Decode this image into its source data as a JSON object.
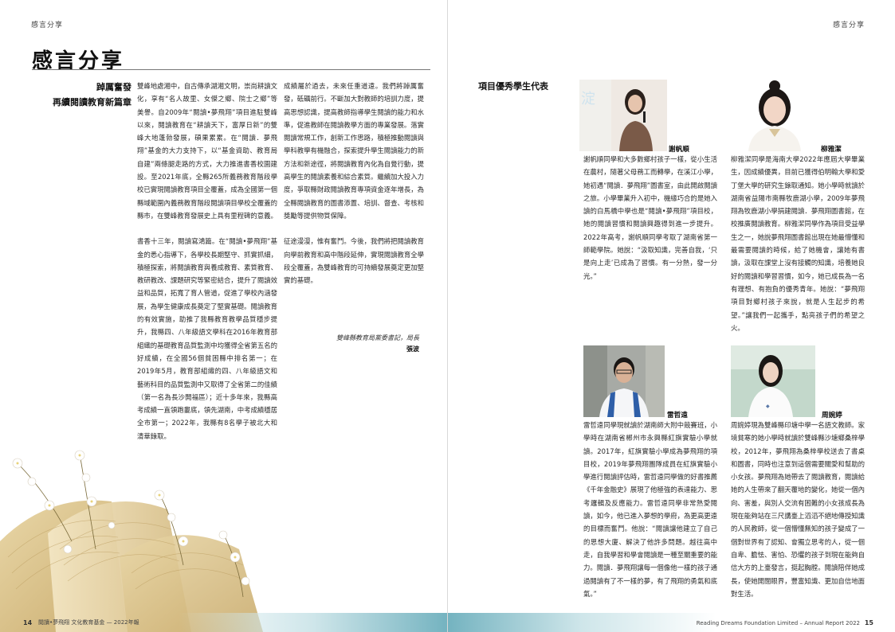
{
  "left_page": {
    "running_head": "感言分享",
    "title": "感言分享",
    "headline_line1": "踔厲奮發",
    "headline_line2": "再續閱讀教育新篇章",
    "col_a_p1": "雙峰地處湘中，自古傳承湖湘文明，崇尚耕讀文化，享有“名人故里、女傑之鄉、院士之鄉”等美譽。自2009年“閱讀•夢飛翔”項目進駐雙峰以來，閱讀教育在“耕讀天下，富厚日新”的雙峰大地蓬勃發展，碩果累累。在“閱讀．夢飛翔”基金的大力支持下，以“基金資助、教育局自建”兩條腿走路的方式，大力推進書香校園建設。至2021年底，全縣265所義務教育階段學校已實現閱讀教育項目全覆蓋，成為全國第一個縣域範圍內義務教育階段閱讀項目學校全覆蓋的縣市，在雙峰教育發展史上具有里程碑的意義。",
    "col_a_p2": "書香十三年，閱讀寫鴻篇。在“閱讀•夢飛翔”基金的悉心指導下，各學校長期堅守、抓實抓細，積極探索，將閱讀教育與養成教育、素質教育、教研教改、課題研究等緊密結合，提升了閱讀效益和品質，拓寬了育人管道，促進了學校內涵發展，為學生健康成長奠定了堅實基礎。閱讀教育的有效實施，助推了我縣教育教學品質穩步提升，我縣四、八年級語文學科在2016年教育部組織的基礎教育品質監測中均獲得全省第五名的好成績，在全國56個貧困縣中排名第一；在2019年5月，教育部組織的四、八年級語文和藝術科目的品質監測中又取得了全省第二的佳績（第一名為長沙開福區）；近十多年來，我縣高考成績一直領跑婁底，領先湖南，中考成績穩居全市第一；2022年，我縣有8名學子被北大和清華錄取。",
    "col_b_p1": "成績屬於過去，未來任重道遠。我們將踔厲奮發，砥礪前行。不斷加大對教師的培訓力度，提高思想認識，提高教師指導學生閱讀的能力和水準，促進教師在閱讀教學方面的專業發展。落實閱讀常規工作，創新工作思路，積極推動閱讀與學科教學有機融合，探索提升學生閱讀能力的新方法和新途徑，將閱讀教育內化為自覺行動，提高學生的閱讀素養和綜合素質。繼續加大投入力度，爭取縣財政閱讀教育專項資金逐年增長，為全縣閱讀教育的圖書添置、培訓、督查、考核和獎勵等提供物質保障。",
    "col_b_p2": "征途漫漫，惟有奮鬥。今後，我們將把閱讀教育向學前教育和高中階段延伸，實現閱讀教育全學段全覆蓋，為雙峰教育的可持續發展奠定更加堅實的基礎。",
    "signature_role": "雙峰縣教育局黨委書記，局長",
    "signature_name": "張波",
    "page_number": "14",
    "footer_text": "閱讀•夢飛翔 文化教育基金 — 2022年報"
  },
  "right_page": {
    "running_head": "感言分享",
    "section_heading": "項目優秀學生代表",
    "students": [
      {
        "name": "謝帆順",
        "bio": "謝帆順同學和大多數鄉村孩子一樣，從小生活在農村，隨著父母務工而轉學，在溪江小學，她初遇“閱讀．夢飛翔”圖書室，由此開啟閱讀之旅。小學畢業升入初中，機緣巧合的是她入讀的白馬橋中學也是“閱讀•夢飛翔”項目校，她的閱讀習慣和閱讀興趣得到進一步提升。2022年高考，謝帆順同學考取了湖南省第一師範學院。她說：“汲取知識，完善自我，‘只是向上走’已成為了習慣。有一分熱，發一分光。”"
      },
      {
        "name": "柳雅潔",
        "bio": "柳雅潔同學是海南大學2022年應屆大學畢業生，因成績優異，目前已獲得伯明翰大學和愛丁堡大學的研究生錄取通知。她小學時就讀於湖南省益陽市南縣牧鹿湖小學，2009年夢飛翔為牧鹿湖小學捐建閱讀．夢飛翔圖書館，在校推廣閱讀教育。柳雅潔同學作為項目受益學生之一，她說夢飛翔圖書館出現在她最懵懂和最需要閱讀的時候，給了她機會，讓她有書讀，汲取在課堂上沒有接觸的知識，培養她良好的閱讀和學習習慣，如今，她已成長為一名有理想、有抱負的優秀青年。她說：“夢飛翔項目對鄉村孩子來說，就是人生起步的希望。”讓我們一起攜手，點亮孩子們的希望之火。"
      },
      {
        "name": "雷哲遠",
        "bio": "雷哲遠同學現就讀於湖南師大附中競賽班，小學時在湖南省郴州市永興縣紅旗實驗小學就讀。2017年，紅旗實驗小學成為夢飛翔的項目校，2019年夢飛翔團隊成員在紅旗實驗小學進行閱讀評估時，雷哲遠同學做的好書推薦《千年金融史》展現了他極強的表達能力、思考邏輯及反應能力。雷哲遠同學非常熱愛閱讀，如今，他已進入夢想的學府，為更高更遠的目標而奮鬥。他說：“閱讀讓他建立了自己的思想大廈、解決了他許多問題。越往高中走，自我學習和學會閱讀是一種至關重要的能力。閱讀．夢飛翔讓每一個像他一樣的孩子通過閱讀有了不一樣的夢，有了飛翔的勇氣和底氣。”"
      },
      {
        "name": "周婉婷",
        "bio": "周婉婷現為雙峰縣印塘中學一名語文教師。家境貧寒的她小學時就讀於雙峰縣沙塘鄉桑梓學校，2012年，夢飛翔為桑梓學校送去了書桌和圖書，同時也注意到這個需要關愛和幫助的小女孩。夢飛翔為她帶去了閱讀教育，閱讀給她的人生帶來了翻天覆地的變化，她從一個內向、害羞，與別人交流有困難的小女孩成長為現在能夠站在三尺講臺上滔滔不絕地傳授知識的人民教師，從一個懵懂無知的孩子變成了一個對世界有了認知、會獨立思考的人，從一個自卑、膽怯、害怕、恐懼的孩子到現在能夠自信大方的上臺發言，挺起胸膛。閱讀陪伴她成長，使她開闊眼界，豐富知識、更加自信地面對生活。"
      }
    ],
    "page_number": "15",
    "footer_text": "Reading Dreams Foundation Limited – Annual Report 2022"
  },
  "colors": {
    "accent_teal": "#74b3c0",
    "text": "#2a2a2a"
  }
}
